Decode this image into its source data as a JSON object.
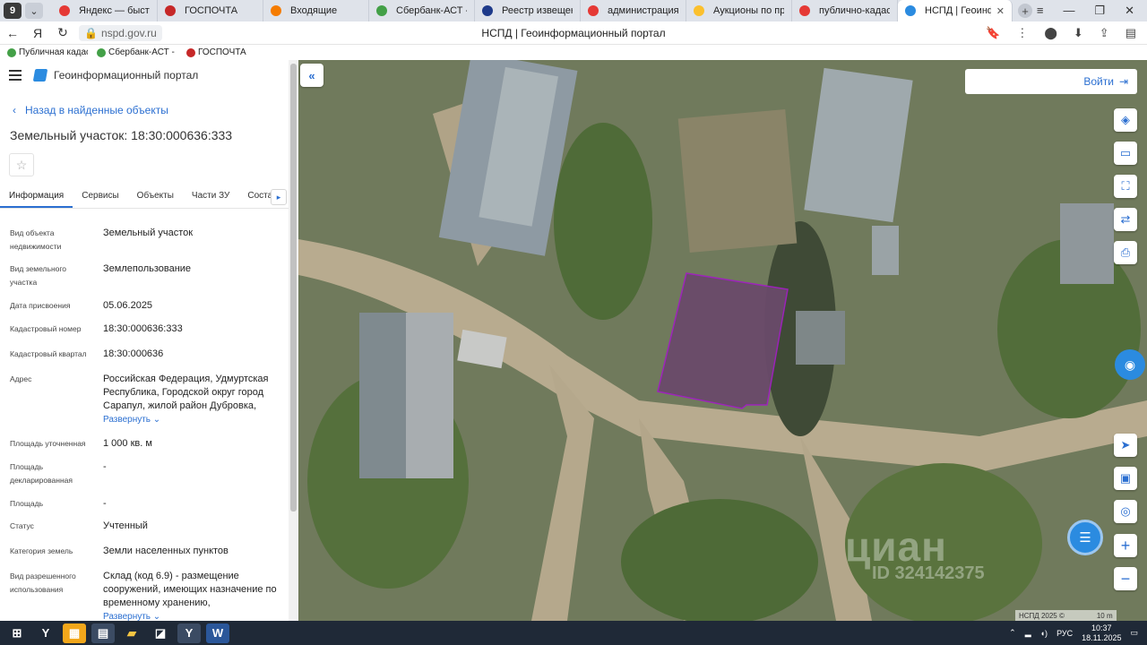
{
  "browser": {
    "profile_badge": "9",
    "tabs": [
      {
        "label": "Яндекс — быстрый по",
        "color": "#e53935"
      },
      {
        "label": "ГОСПОЧТА",
        "color": "#c62828"
      },
      {
        "label": "Входящие",
        "color": "#f57c00"
      },
      {
        "label": "Сбербанк-АСТ - Элек",
        "color": "#43a047"
      },
      {
        "label": "Реестр извещений",
        "color": "#1e3a8a"
      },
      {
        "label": "администрация сара",
        "color": "#e53935"
      },
      {
        "label": "Аукционы по продаж",
        "color": "#fbc02d"
      },
      {
        "label": "публично-кадастро",
        "color": "#e53935"
      },
      {
        "label": "НСПД | Геоинформ",
        "color": "#2b8be0",
        "active": true
      }
    ],
    "url": "nspd.gov.ru",
    "page_title": "НСПД | Геоинформационный портал",
    "bookmarks": [
      {
        "label": "Публичная кадаст",
        "color": "#43a047"
      },
      {
        "label": "Сбербанк-АСТ - Э",
        "color": "#43a047"
      },
      {
        "label": "ГОСПОЧТА",
        "color": "#c62828"
      }
    ]
  },
  "panel": {
    "portal_name": "Геоинформационный портал",
    "back_link": "Назад в найденные объекты",
    "title": "Земельный участок: 18:30:000636:333",
    "tabs": [
      "Информация",
      "Сервисы",
      "Объекты",
      "Части ЗУ",
      "Соста"
    ],
    "fields": [
      {
        "label": "Вид объекта недвижимости",
        "value": "Земельный участок"
      },
      {
        "label": "Вид земельного участка",
        "value": "Землепользование"
      },
      {
        "label": "Дата присвоения",
        "value": "05.06.2025"
      },
      {
        "label": "Кадастровый номер",
        "value": "18:30:000636:333"
      },
      {
        "label": "Кадастровый квартал",
        "value": "18:30:000636"
      },
      {
        "label": "Адрес",
        "value": "Российская Федерация, Удмуртская Республика, Городской округ город Сарапул, жилой район Дубровка,",
        "expand": "Развернуть"
      },
      {
        "label": "Площадь уточненная",
        "value": "1 000 кв. м"
      },
      {
        "label": "Площадь декларированная",
        "value": "-"
      },
      {
        "label": "Площадь",
        "value": "-"
      },
      {
        "label": "Статус",
        "value": "Учтенный"
      },
      {
        "label": "Категория земель",
        "value": "Земли населенных пунктов"
      },
      {
        "label": "Вид разрешенного использования",
        "value": "Склад (код 6.9) - размещение сооружений, имеющих назначение по временному хранению,",
        "expand": "Развернуть"
      }
    ]
  },
  "map": {
    "login_label": "Войти",
    "watermark": "циан",
    "watermark_id": "ID 324142375",
    "attribution": "НСПД 2025 ©",
    "scale": "10 m",
    "parcel_color": "#a020c0"
  },
  "taskbar": {
    "lang": "РУС",
    "time": "10:37",
    "date": "18.11.2025"
  }
}
